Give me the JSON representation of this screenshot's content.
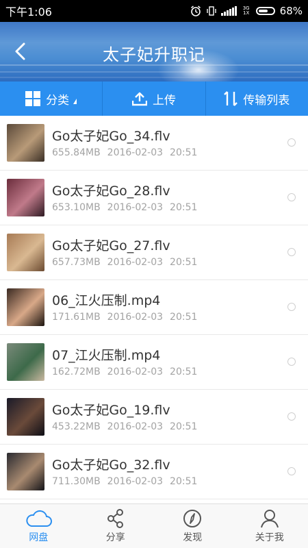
{
  "status": {
    "time": "下午1:06",
    "network": "3G 1X",
    "battery": "68%",
    "battery_level": 0.68
  },
  "header": {
    "title": "太子妃升职记"
  },
  "toolbar": {
    "category_label": "分类",
    "upload_label": "上传",
    "transfer_label": "传输列表"
  },
  "files": [
    {
      "name": "Go太子妃Go_34.flv",
      "size": "655.84MB",
      "date": "2016-02-03",
      "time": "20:51",
      "colors": [
        "#5b4a3a",
        "#b89a78",
        "#3a2f25"
      ]
    },
    {
      "name": "Go太子妃Go_28.flv",
      "size": "653.10MB",
      "date": "2016-02-03",
      "time": "20:51",
      "colors": [
        "#6b2d3c",
        "#c07a8a",
        "#2e1a22"
      ]
    },
    {
      "name": "Go太子妃Go_27.flv",
      "size": "657.73MB",
      "date": "2016-02-03",
      "time": "20:51",
      "colors": [
        "#a77b55",
        "#d9b891",
        "#6b4a30"
      ]
    },
    {
      "name": "06_江火压制.mp4",
      "size": "171.61MB",
      "date": "2016-02-03",
      "time": "20:51",
      "colors": [
        "#3a2a22",
        "#d8a888",
        "#1c140f"
      ]
    },
    {
      "name": "07_江火压制.mp4",
      "size": "162.72MB",
      "date": "2016-02-03",
      "time": "20:51",
      "colors": [
        "#7a8a7a",
        "#3d6a4a",
        "#c9b8a0"
      ]
    },
    {
      "name": "Go太子妃Go_19.flv",
      "size": "453.22MB",
      "date": "2016-02-03",
      "time": "20:51",
      "colors": [
        "#1a1a28",
        "#6a4a3a",
        "#0e0e16"
      ]
    },
    {
      "name": "Go太子妃Go_32.flv",
      "size": "711.30MB",
      "date": "2016-02-03",
      "time": "20:51",
      "colors": [
        "#2a2a30",
        "#a88a70",
        "#141418"
      ]
    }
  ],
  "nav": {
    "items": [
      {
        "label": "网盘",
        "icon": "cloud-icon",
        "active": true
      },
      {
        "label": "分享",
        "icon": "share-icon",
        "active": false
      },
      {
        "label": "发现",
        "icon": "compass-icon",
        "active": false
      },
      {
        "label": "关于我",
        "icon": "person-icon",
        "active": false
      }
    ]
  },
  "colors": {
    "accent": "#2b8ff0",
    "text": "#333333",
    "meta": "#a3a3a3"
  }
}
